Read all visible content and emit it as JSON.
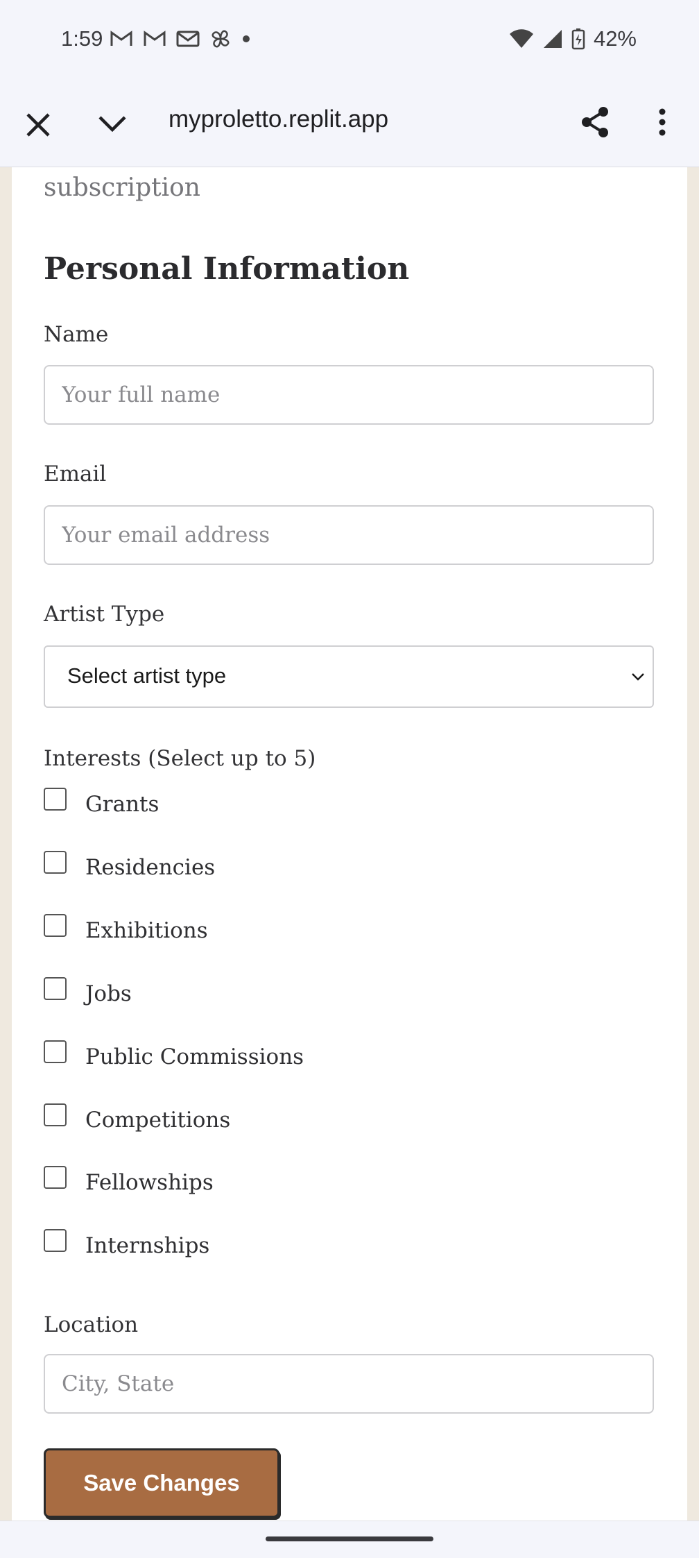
{
  "status_bar": {
    "time": "1:59",
    "battery": "42%",
    "icons": [
      "gmail-icon",
      "gmail-icon",
      "mail-icon",
      "pinwheel-icon",
      "dot-icon",
      "wifi-icon",
      "signal-icon",
      "battery-charging-icon"
    ]
  },
  "browser": {
    "url": "myproletto.replit.app",
    "buttons": [
      "close-icon",
      "chevron-down-icon",
      "share-icon",
      "more-vert-icon"
    ]
  },
  "page": {
    "subscription_text": "subscription",
    "section_title": "Personal Information",
    "name_label": "Name",
    "name_placeholder": "Your full name",
    "email_label": "Email",
    "email_placeholder": "Your email address",
    "artist_type_label": "Artist Type",
    "artist_type_value": "Select artist type",
    "interests_label": "Interests (Select up to 5)",
    "interests": [
      {
        "label": "Grants",
        "checked": false
      },
      {
        "label": "Residencies",
        "checked": false
      },
      {
        "label": "Exhibitions",
        "checked": false
      },
      {
        "label": "Jobs",
        "checked": false
      },
      {
        "label": "Public Commissions",
        "checked": false
      },
      {
        "label": "Competitions",
        "checked": false
      },
      {
        "label": "Fellowships",
        "checked": false
      },
      {
        "label": "Internships",
        "checked": false
      }
    ],
    "location_label": "Location",
    "location_placeholder": "City, State",
    "save_label": "Save Changes"
  },
  "colors": {
    "accent": "#a86c42",
    "page_background": "#efe9df",
    "chrome_background": "#f4f5fb"
  }
}
